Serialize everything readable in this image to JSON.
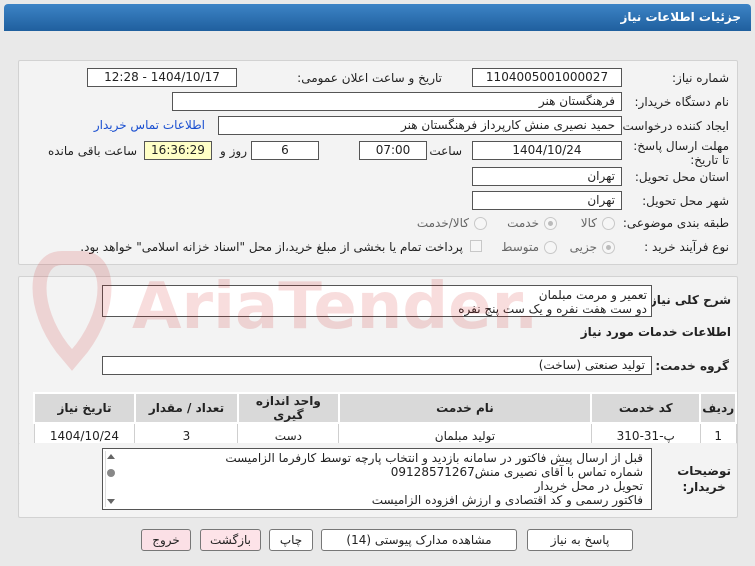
{
  "window": {
    "title": "جزئیات اطلاعات نیاز"
  },
  "form": {
    "need_number_label": "شماره نیاز:",
    "need_number": "1104005001000027",
    "announce_label": "تاریخ و ساعت اعلان عمومی:",
    "announce_value": "1404/10/17 - 12:28",
    "buyer_org_label": "نام دستگاه خریدار:",
    "buyer_org": "فرهنگستان هنر",
    "creator_label": "ایجاد کننده درخواست:",
    "creator": "حمید نصیری منش کارپرداز فرهنگستان هنر",
    "contact_link": "اطلاعات تماس خریدار",
    "deadline_label": "مهلت ارسال پاسخ: تا تاریخ:",
    "deadline_date": "1404/10/24",
    "time_label": "ساعت",
    "deadline_time": "07:00",
    "days_value": "6",
    "days_label": "روز و",
    "remaining_time": "16:36:29",
    "remaining_label": "ساعت باقی مانده",
    "province_label": "استان محل تحویل:",
    "province": "تهران",
    "city_label": "شهر محل تحویل:",
    "city": "تهران",
    "category_label": "طبقه بندی موضوعی:",
    "category_options": [
      "کالا",
      "خدمت",
      "کالا/خدمت"
    ],
    "process_label": "نوع فرآیند خرید :",
    "process_options": [
      "جزیی",
      "متوسط"
    ],
    "payment_note": "پرداخت تمام یا بخشی از مبلغ خرید،از محل \"اسناد خزانه اسلامی\" خواهد بود."
  },
  "description": {
    "label": "شرح کلی نیاز:",
    "line1": "تعمیر و مرمت مبلمان",
    "line2": "دو ست هفت نفره و یک ست پنج نفره"
  },
  "services": {
    "section_title": "اطلاعات خدمات مورد نیاز",
    "group_label": "گروه خدمت:",
    "group_value": "تولید صنعتی (ساخت)",
    "columns": [
      "ردیف",
      "کد خدمت",
      "نام خدمت",
      "واحد اندازه گیری",
      "تعداد / مقدار",
      "تاریخ نیاز"
    ],
    "rows": [
      {
        "row": "1",
        "code": "پ-31-310",
        "name": "تولید مبلمان",
        "unit": "دست",
        "qty": "3",
        "date": "1404/10/24"
      }
    ]
  },
  "buyer_notes": {
    "label_line1": "توضیحات",
    "label_line2": "خریدار:",
    "lines": [
      "قبل از ارسال پیش فاکتور در سامانه بازدید و انتخاب پارچه توسط کارفرما الزامیست",
      "شماره تماس با آقای نصیری منش09128571267",
      "تحویل در محل خریدار",
      "فاکتور رسمی و کد اقتصادی و ارزش افزوده الزامیست"
    ]
  },
  "buttons": {
    "reply": "پاسخ به نیاز",
    "attachments": "مشاهده مدارک پیوستی (14)",
    "print": "چاپ",
    "back": "بازگشت",
    "exit": "خروج"
  },
  "watermark": {
    "text": "AriaTender.net"
  },
  "colors": {
    "title_bar": "#2a6db0",
    "link": "#1a4fd0",
    "remaining_bg": "#ffffc6"
  }
}
